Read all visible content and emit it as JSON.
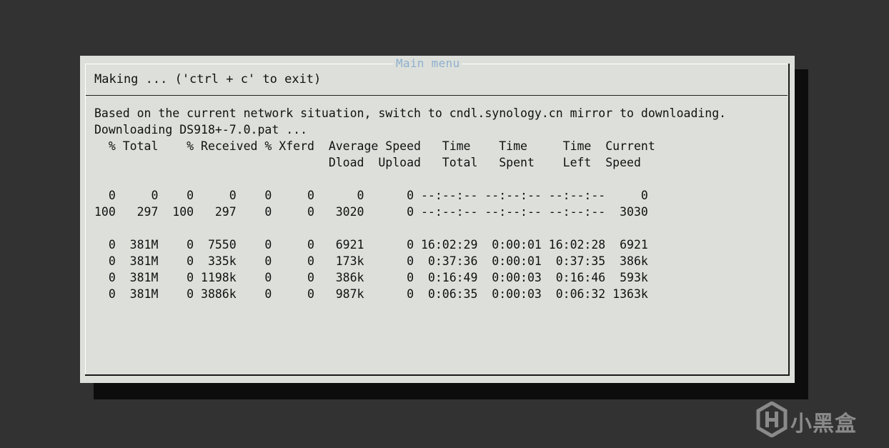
{
  "dialog": {
    "title": "Main menu",
    "status": "Making ... ('ctrl + c' to exit)"
  },
  "terminal": {
    "line1": "Based on the current network situation, switch to cndl.synology.cn mirror to downloading.",
    "line2": "Downloading DS918+-7.0.pat ...",
    "header1": "  % Total    % Received % Xferd  Average Speed   Time    Time     Time  Current",
    "header2": "                                 Dload  Upload   Total   Spent    Left  Speed",
    "blank1": "",
    "rows": [
      "  0     0    0     0    0     0      0      0 --:--:-- --:--:-- --:--:--     0",
      "100   297  100   297    0     0   3020      0 --:--:-- --:--:-- --:--:--  3030",
      "",
      "  0  381M    0  7550    0     0   6921      0 16:02:29  0:00:01 16:02:28  6921",
      "  0  381M    0  335k    0     0   173k      0  0:37:36  0:00:01  0:37:35  386k",
      "  0  381M    0 1198k    0     0   386k      0  0:16:49  0:00:03  0:16:46  593k",
      "  0  381M    0 3886k    0     0   987k      0  0:06:35  0:00:03  0:06:32 1363k"
    ]
  },
  "watermark": {
    "icon": "heybox-logo-icon",
    "text": "小黑盒"
  }
}
